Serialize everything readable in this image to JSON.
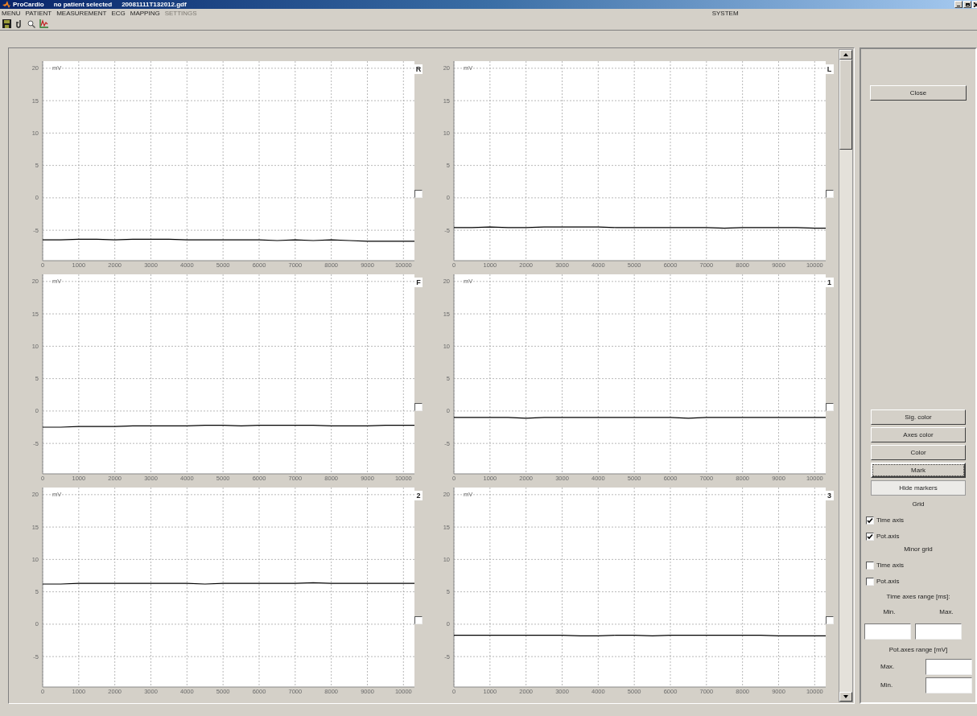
{
  "window": {
    "title_parts": [
      "ProCardio",
      "no patient selected",
      "20081111T132012.gdf"
    ]
  },
  "menu": [
    {
      "label": "MENU",
      "disabled": false
    },
    {
      "label": "PATIENT",
      "disabled": false
    },
    {
      "label": "MEASUREMENT",
      "disabled": false
    },
    {
      "label": "ECG",
      "disabled": false
    },
    {
      "label": "MAPPING",
      "disabled": false
    },
    {
      "label": "SETTINGS",
      "disabled": true
    }
  ],
  "menu_right": "SYSTEM",
  "plots": [
    {
      "label": "R",
      "checked": false,
      "chart_data": {
        "type": "line",
        "grid": true,
        "ylabel": "mV",
        "xlim": [
          0,
          10350
        ],
        "ylim": [
          -9.7,
          21.1
        ],
        "xticks": [
          0,
          1000,
          2000,
          3000,
          4000,
          5000,
          6000,
          7000,
          8000,
          9000,
          10000
        ],
        "yticks": [
          -5,
          0,
          5,
          10,
          15,
          20
        ],
        "x": [
          0,
          500,
          1000,
          1500,
          2000,
          2500,
          3000,
          3500,
          4000,
          4500,
          5000,
          5500,
          6000,
          6500,
          7000,
          7500,
          8000,
          8500,
          9000,
          9500,
          10000,
          10350
        ],
        "series": [
          {
            "color": "#000000",
            "values": [
              -6.5,
              -6.5,
              -6.4,
              -6.4,
              -6.5,
              -6.4,
              -6.4,
              -6.4,
              -6.5,
              -6.5,
              -6.5,
              -6.5,
              -6.5,
              -6.6,
              -6.5,
              -6.6,
              -6.5,
              -6.6,
              -6.7,
              -6.7,
              -6.7,
              -6.7
            ]
          }
        ]
      }
    },
    {
      "label": "L",
      "checked": false,
      "chart_data": {
        "type": "line",
        "grid": true,
        "ylabel": "mV",
        "xlim": [
          0,
          10350
        ],
        "ylim": [
          -9.7,
          21.1
        ],
        "xticks": [
          0,
          1000,
          2000,
          3000,
          4000,
          5000,
          6000,
          7000,
          8000,
          9000,
          10000
        ],
        "yticks": [
          -5,
          0,
          5,
          10,
          15,
          20
        ],
        "x": [
          0,
          500,
          1000,
          1500,
          2000,
          2500,
          3000,
          3500,
          4000,
          4500,
          5000,
          5500,
          6000,
          6500,
          7000,
          7500,
          8000,
          8500,
          9000,
          9500,
          10000,
          10350
        ],
        "series": [
          {
            "color": "#000000",
            "values": [
              -4.6,
              -4.6,
              -4.5,
              -4.6,
              -4.6,
              -4.5,
              -4.5,
              -4.5,
              -4.5,
              -4.6,
              -4.6,
              -4.6,
              -4.6,
              -4.6,
              -4.6,
              -4.7,
              -4.6,
              -4.6,
              -4.6,
              -4.6,
              -4.7,
              -4.7
            ]
          }
        ]
      }
    },
    {
      "label": "F",
      "checked": false,
      "chart_data": {
        "type": "line",
        "grid": true,
        "ylabel": "mV",
        "xlim": [
          0,
          10350
        ],
        "ylim": [
          -9.7,
          21.1
        ],
        "xticks": [
          0,
          1000,
          2000,
          3000,
          4000,
          5000,
          6000,
          7000,
          8000,
          9000,
          10000
        ],
        "yticks": [
          -5,
          0,
          5,
          10,
          15,
          20
        ],
        "x": [
          0,
          500,
          1000,
          1500,
          2000,
          2500,
          3000,
          3500,
          4000,
          4500,
          5000,
          5500,
          6000,
          6500,
          7000,
          7500,
          8000,
          8500,
          9000,
          9500,
          10000,
          10350
        ],
        "series": [
          {
            "color": "#000000",
            "values": [
              -2.5,
              -2.5,
              -2.4,
              -2.4,
              -2.4,
              -2.3,
              -2.3,
              -2.3,
              -2.3,
              -2.2,
              -2.2,
              -2.3,
              -2.2,
              -2.2,
              -2.2,
              -2.2,
              -2.3,
              -2.3,
              -2.3,
              -2.2,
              -2.2,
              -2.2
            ]
          }
        ]
      }
    },
    {
      "label": "1",
      "checked": false,
      "chart_data": {
        "type": "line",
        "grid": true,
        "ylabel": "mV",
        "xlim": [
          0,
          10350
        ],
        "ylim": [
          -9.7,
          21.1
        ],
        "xticks": [
          0,
          1000,
          2000,
          3000,
          4000,
          5000,
          6000,
          7000,
          8000,
          9000,
          10000
        ],
        "yticks": [
          -5,
          0,
          5,
          10,
          15,
          20
        ],
        "x": [
          0,
          500,
          1000,
          1500,
          2000,
          2500,
          3000,
          3500,
          4000,
          4500,
          5000,
          5500,
          6000,
          6500,
          7000,
          7500,
          8000,
          8500,
          9000,
          9500,
          10000,
          10350
        ],
        "series": [
          {
            "color": "#000000",
            "values": [
              -1.0,
              -1.0,
              -1.0,
              -1.0,
              -1.1,
              -1.0,
              -1.0,
              -1.0,
              -1.0,
              -1.0,
              -1.0,
              -1.0,
              -1.0,
              -1.1,
              -1.0,
              -1.0,
              -1.0,
              -1.0,
              -1.0,
              -1.0,
              -1.0,
              -1.0
            ]
          }
        ]
      }
    },
    {
      "label": "2",
      "checked": false,
      "chart_data": {
        "type": "line",
        "grid": true,
        "ylabel": "mV",
        "xlim": [
          0,
          10350
        ],
        "ylim": [
          -9.7,
          21.1
        ],
        "xticks": [
          0,
          1000,
          2000,
          3000,
          4000,
          5000,
          6000,
          7000,
          8000,
          9000,
          10000
        ],
        "yticks": [
          -5,
          0,
          5,
          10,
          15,
          20
        ],
        "x": [
          0,
          500,
          1000,
          1500,
          2000,
          2500,
          3000,
          3500,
          4000,
          4500,
          5000,
          5500,
          6000,
          6500,
          7000,
          7500,
          8000,
          8500,
          9000,
          9500,
          10000,
          10350
        ],
        "series": [
          {
            "color": "#000000",
            "values": [
              6.2,
              6.2,
              6.3,
              6.3,
              6.3,
              6.3,
              6.3,
              6.3,
              6.3,
              6.2,
              6.3,
              6.3,
              6.3,
              6.3,
              6.3,
              6.4,
              6.3,
              6.3,
              6.3,
              6.3,
              6.3,
              6.3
            ]
          }
        ]
      }
    },
    {
      "label": "3",
      "checked": false,
      "chart_data": {
        "type": "line",
        "grid": true,
        "ylabel": "mV",
        "xlim": [
          0,
          10350
        ],
        "ylim": [
          -9.7,
          21.1
        ],
        "xticks": [
          0,
          1000,
          2000,
          3000,
          4000,
          5000,
          6000,
          7000,
          8000,
          9000,
          10000
        ],
        "yticks": [
          -5,
          0,
          5,
          10,
          15,
          20
        ],
        "x": [
          0,
          500,
          1000,
          1500,
          2000,
          2500,
          3000,
          3500,
          4000,
          4500,
          5000,
          5500,
          6000,
          6500,
          7000,
          7500,
          8000,
          8500,
          9000,
          9500,
          10000,
          10350
        ],
        "series": [
          {
            "color": "#000000",
            "values": [
              -1.7,
              -1.7,
              -1.7,
              -1.7,
              -1.7,
              -1.7,
              -1.7,
              -1.8,
              -1.8,
              -1.7,
              -1.7,
              -1.8,
              -1.7,
              -1.7,
              -1.7,
              -1.7,
              -1.7,
              -1.7,
              -1.8,
              -1.8,
              -1.8,
              -1.8
            ]
          }
        ]
      }
    }
  ],
  "side_panel": {
    "close": "Close",
    "buttons": [
      {
        "label": "Sig. color",
        "focused": false,
        "pressed": false
      },
      {
        "label": "Axes color",
        "focused": false,
        "pressed": false
      },
      {
        "label": "Color",
        "focused": false,
        "pressed": false
      },
      {
        "label": "Mark",
        "focused": true,
        "pressed": false
      },
      {
        "label": "Hide markers",
        "focused": false,
        "pressed": true
      }
    ],
    "grid": {
      "title": "Grid",
      "options": [
        {
          "label": "Time axis",
          "checked": true
        },
        {
          "label": "Pot.axis",
          "checked": true
        }
      ]
    },
    "minor_grid": {
      "title": "Minor grid",
      "options": [
        {
          "label": "Time axis",
          "checked": false
        },
        {
          "label": "Pot.axis",
          "checked": false
        }
      ]
    },
    "time_range": {
      "title": "Time axes range [ms]:",
      "min_label": "Min.",
      "max_label": "Max."
    },
    "pot_range": {
      "title": "Pot.axes range [mV]",
      "max_label": "Max.",
      "min_label": "Min."
    }
  }
}
